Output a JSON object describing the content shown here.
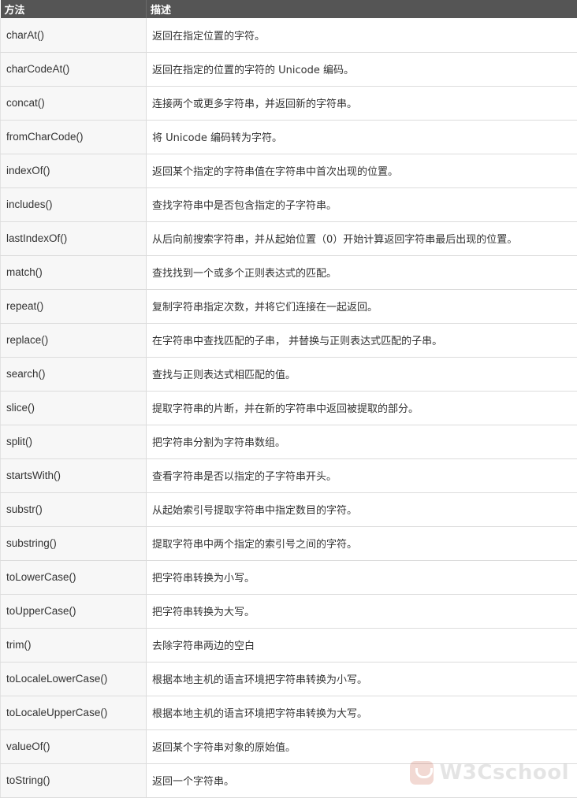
{
  "table": {
    "headers": [
      "方法",
      "描述"
    ],
    "rows": [
      [
        "charAt()",
        "返回在指定位置的字符。"
      ],
      [
        "charCodeAt()",
        "返回在指定的位置的字符的 Unicode 编码。"
      ],
      [
        "concat()",
        "连接两个或更多字符串，并返回新的字符串。"
      ],
      [
        "fromCharCode()",
        "将 Unicode 编码转为字符。"
      ],
      [
        "indexOf()",
        "返回某个指定的字符串值在字符串中首次出现的位置。"
      ],
      [
        "includes()",
        "查找字符串中是否包含指定的子字符串。"
      ],
      [
        "lastIndexOf()",
        "从后向前搜索字符串，并从起始位置（0）开始计算返回字符串最后出现的位置。"
      ],
      [
        "match()",
        "查找找到一个或多个正则表达式的匹配。"
      ],
      [
        "repeat()",
        "复制字符串指定次数，并将它们连接在一起返回。"
      ],
      [
        "replace()",
        "在字符串中查找匹配的子串， 并替换与正则表达式匹配的子串。"
      ],
      [
        "search()",
        "查找与正则表达式相匹配的值。"
      ],
      [
        "slice()",
        "提取字符串的片断，并在新的字符串中返回被提取的部分。"
      ],
      [
        "split()",
        "把字符串分割为字符串数组。"
      ],
      [
        "startsWith()",
        "查看字符串是否以指定的子字符串开头。"
      ],
      [
        "substr()",
        "从起始索引号提取字符串中指定数目的字符。"
      ],
      [
        "substring()",
        "提取字符串中两个指定的索引号之间的字符。"
      ],
      [
        "toLowerCase()",
        "把字符串转换为小写。"
      ],
      [
        "toUpperCase()",
        "把字符串转换为大写。"
      ],
      [
        "trim()",
        "去除字符串两边的空白"
      ],
      [
        "toLocaleLowerCase()",
        "根据本地主机的语言环境把字符串转换为小写。"
      ],
      [
        "toLocaleUpperCase()",
        "根据本地主机的语言环境把字符串转换为大写。"
      ],
      [
        "valueOf()",
        "返回某个字符串对象的原始值。"
      ],
      [
        "toString()",
        "返回一个字符串。"
      ]
    ]
  },
  "watermark": {
    "text": "W3Cschool",
    "logo_icon": "w3cschool-logo-icon",
    "color": "#8a8a8a"
  },
  "colors": {
    "header_bg": "#555555",
    "header_text": "#ffffff",
    "first_col_bg": "#f7f7f7",
    "border": "#dcdcdc",
    "text": "#333333"
  }
}
